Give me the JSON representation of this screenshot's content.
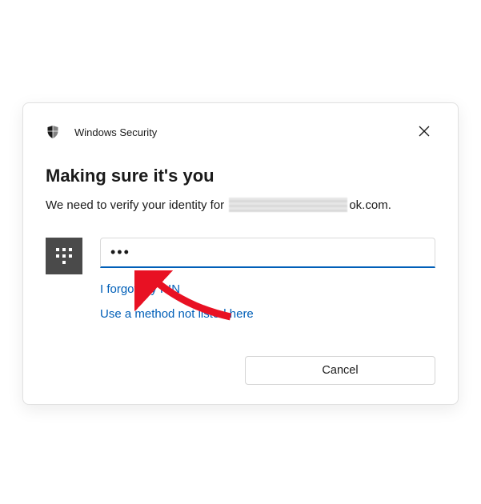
{
  "header": {
    "app_title": "Windows Security"
  },
  "dialog": {
    "heading": "Making sure it's you",
    "subtitle_prefix": "We need to verify your identity for",
    "subtitle_suffix": "ok.com.",
    "pin_value": "•••",
    "forgot_pin_label": "I forgot my PIN",
    "alt_method_label": "Use a method not listed here",
    "cancel_label": "Cancel"
  },
  "colors": {
    "accent": "#005fb8",
    "keypad_bg": "#4a4a4a"
  }
}
